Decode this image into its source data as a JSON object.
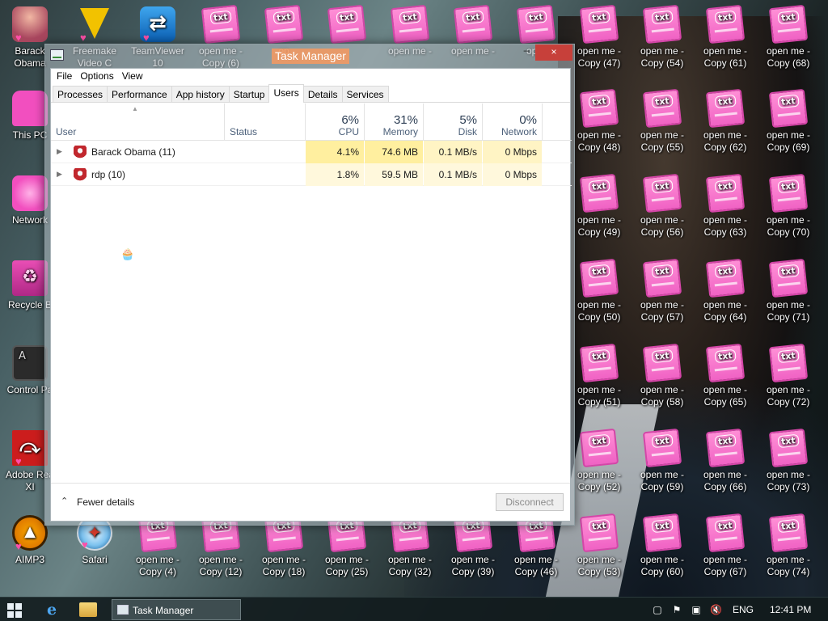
{
  "desktop": {
    "column1": [
      {
        "label": "Barack\nObama",
        "icon": "user-doll-icon"
      },
      {
        "label": "This PC",
        "icon": "pink-monitor-icon"
      },
      {
        "label": "Network",
        "icon": "pink-network-icon"
      },
      {
        "label": "Recycle B",
        "icon": "recycle-bin-icon"
      },
      {
        "label": "Control Pa",
        "icon": "control-panel-icon"
      },
      {
        "label": "Adobe Rea\nXI",
        "icon": "adobe-reader-icon"
      },
      {
        "label": "AIMP3",
        "icon": "aimp-icon"
      }
    ],
    "top_row": [
      {
        "label": "Freemake\nVideo C",
        "icon": "freemake-icon"
      },
      {
        "label": "TeamViewer\n10",
        "icon": "teamviewer-icon"
      },
      {
        "label": "open me -\nCopy (6)",
        "icon": "pink-notebook-icon"
      },
      {
        "label": "op",
        "icon": "pink-notebook-icon"
      },
      {
        "label": "",
        "icon": "pink-notebook-icon"
      },
      {
        "label": "open me -",
        "icon": "pink-notebook-icon"
      },
      {
        "label": "open me -",
        "icon": "pink-notebook-icon"
      },
      {
        "label": "oper",
        "icon": "pink-notebook-icon"
      }
    ],
    "bottom_row": [
      {
        "label": "Safari",
        "icon": "safari-icon"
      },
      {
        "label": "open me -\nCopy (4)",
        "icon": "pink-notebook-icon"
      },
      {
        "label": "open me -\nCopy (12)",
        "icon": "pink-notebook-icon"
      },
      {
        "label": "open me -\nCopy (18)",
        "icon": "pink-notebook-icon"
      },
      {
        "label": "open me -\nCopy (25)",
        "icon": "pink-notebook-icon"
      },
      {
        "label": "open me -\nCopy (32)",
        "icon": "pink-notebook-icon"
      },
      {
        "label": "open me -\nCopy (39)",
        "icon": "pink-notebook-icon"
      },
      {
        "label": "open me -\nCopy (46)",
        "icon": "pink-notebook-icon"
      }
    ],
    "right_grid": [
      [
        "open me -\nCopy (47)",
        "open me -\nCopy (54)",
        "open me -\nCopy (61)",
        "open me -\nCopy (68)"
      ],
      [
        "open me -\nCopy (48)",
        "open me -\nCopy (55)",
        "open me -\nCopy (62)",
        "open me -\nCopy (69)"
      ],
      [
        "open me -\nCopy (49)",
        "open me -\nCopy (56)",
        "open me -\nCopy (63)",
        "open me -\nCopy (70)"
      ],
      [
        "open me -\nCopy (50)",
        "open me -\nCopy (57)",
        "open me -\nCopy (64)",
        "open me -\nCopy (71)"
      ],
      [
        "open me -\nCopy (51)",
        "open me -\nCopy (58)",
        "open me -\nCopy (65)",
        "open me -\nCopy (72)"
      ],
      [
        "open me -\nCopy (52)",
        "open me -\nCopy (59)",
        "open me -\nCopy (66)",
        "open me -\nCopy (73)"
      ],
      [
        "open me -\nCopy (53)",
        "open me -\nCopy (60)",
        "open me -\nCopy (67)",
        "open me -\nCopy (74)"
      ]
    ]
  },
  "task_manager": {
    "title": "Task Manager",
    "minimize_glyph": "–",
    "close_glyph": "×",
    "menu": [
      "File",
      "Options",
      "View"
    ],
    "tabs": [
      "Processes",
      "Performance",
      "App history",
      "Startup",
      "Users",
      "Details",
      "Services"
    ],
    "active_tab": "Users",
    "columns": {
      "user": "User",
      "status": "Status",
      "cpu": {
        "pct": "6%",
        "name": "CPU"
      },
      "memory": {
        "pct": "31%",
        "name": "Memory"
      },
      "disk": {
        "pct": "5%",
        "name": "Disk"
      },
      "network": {
        "pct": "0%",
        "name": "Network"
      }
    },
    "rows": [
      {
        "user": "Barack Obama (11)",
        "status": "",
        "cpu": "4.1%",
        "memory": "74.6 MB",
        "disk": "0.1 MB/s",
        "network": "0 Mbps"
      },
      {
        "user": "rdp (10)",
        "status": "",
        "cpu": "1.8%",
        "memory": "59.5 MB",
        "disk": "0.1 MB/s",
        "network": "0 Mbps"
      }
    ],
    "footer": {
      "fewer_details": "Fewer details",
      "disconnect": "Disconnect"
    }
  },
  "taskbar": {
    "running_app": "Task Manager",
    "language": "ENG",
    "clock": "12:41 PM"
  }
}
